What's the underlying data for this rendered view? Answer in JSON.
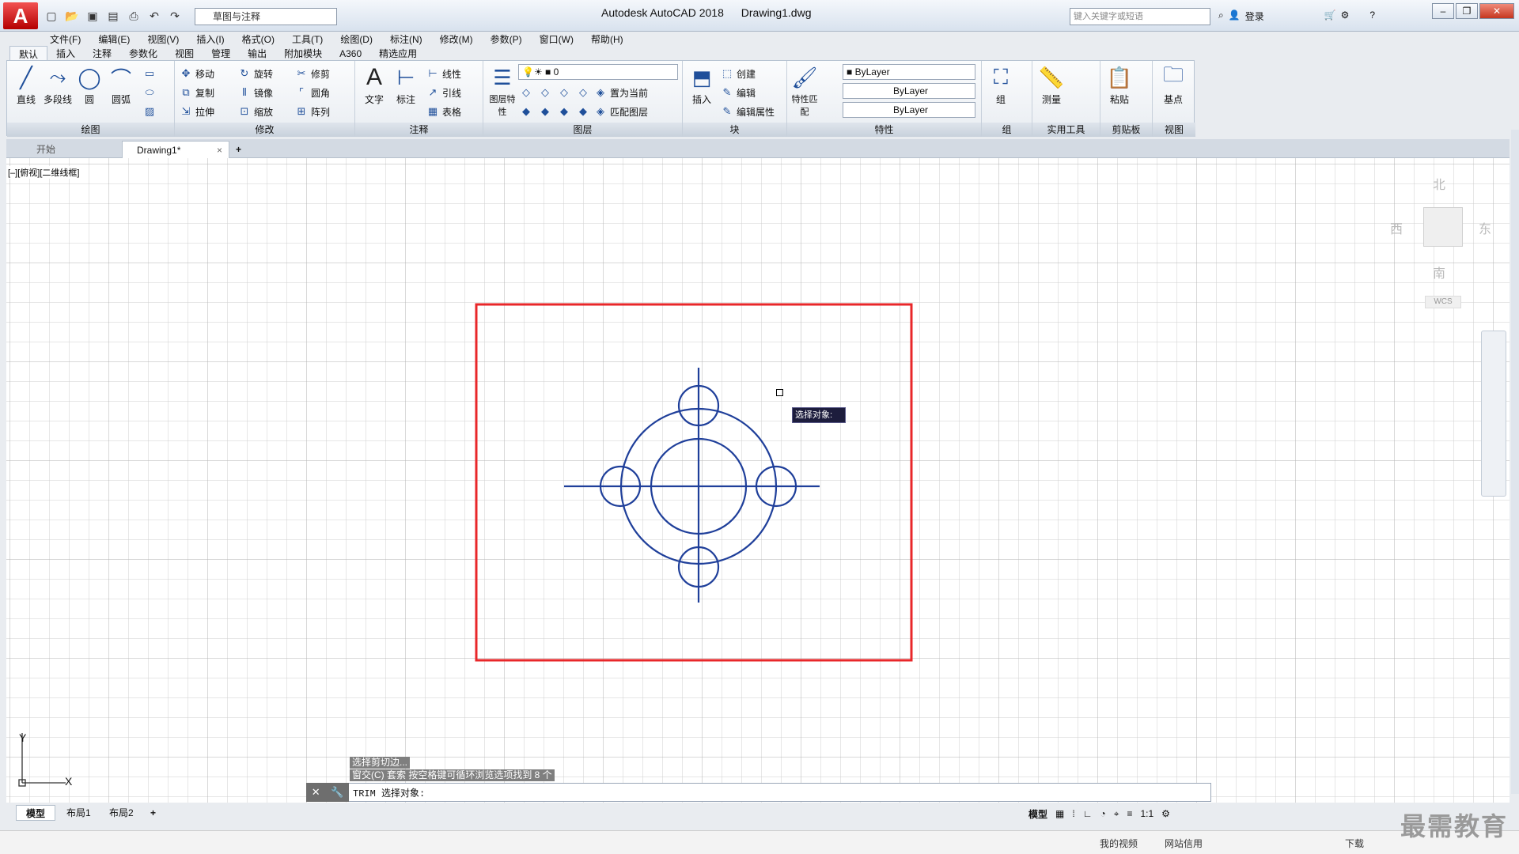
{
  "app": {
    "logo_letter": "A",
    "title": "Autodesk AutoCAD 2018",
    "file": "Drawing1.dwg"
  },
  "quick_access": {
    "workspace": "草图与注释"
  },
  "search": {
    "placeholder": "键入关键字或短语",
    "login": "登录"
  },
  "window_controls": {
    "minimize": "–",
    "restore": "❐",
    "close": "✕"
  },
  "menu": [
    "文件(F)",
    "编辑(E)",
    "视图(V)",
    "插入(I)",
    "格式(O)",
    "工具(T)",
    "绘图(D)",
    "标注(N)",
    "修改(M)",
    "参数(P)",
    "窗口(W)",
    "帮助(H)"
  ],
  "ribbon_tabs": [
    "默认",
    "插入",
    "注释",
    "参数化",
    "视图",
    "管理",
    "输出",
    "附加模块",
    "A360",
    "精选应用"
  ],
  "ribbon": {
    "draw": {
      "title": "绘图",
      "line": "直线",
      "polyline": "多段线",
      "circle": "圆",
      "arc": "圆弧"
    },
    "modify": {
      "title": "修改",
      "move": "移动",
      "rotate": "旋转",
      "trim": "修剪",
      "copy": "复制",
      "mirror": "镜像",
      "fillet": "圆角",
      "stretch": "拉伸",
      "scale": "缩放",
      "array": "阵列"
    },
    "annotation": {
      "title": "注释",
      "text": "文字",
      "dimension": "标注",
      "linear": "线性",
      "leader": "引线",
      "table": "表格"
    },
    "layers": {
      "title": "图层",
      "props": "图层特性",
      "current_layer": "0",
      "set_current": "置为当前",
      "match_layer": "匹配图层"
    },
    "block": {
      "title": "块",
      "insert": "插入",
      "create": "创建",
      "edit": "编辑",
      "edit_attr": "编辑属性"
    },
    "properties": {
      "title": "特性",
      "match": "特性匹配",
      "color": "ByLayer",
      "linetype": "ByLayer",
      "lineweight": "ByLayer"
    },
    "groups": {
      "title": "组",
      "group": "组"
    },
    "utilities": {
      "title": "实用工具",
      "measure": "测量"
    },
    "clipboard": {
      "title": "剪贴板",
      "paste": "粘贴"
    },
    "view": {
      "title": "视图",
      "base": "基点"
    }
  },
  "file_tabs": {
    "start": "开始",
    "drawing": "Drawing1*",
    "close": "×",
    "add": "+"
  },
  "viewport_label": "[–][俯视][二维线框]",
  "viewcube": {
    "north": "北",
    "south": "南",
    "east": "东",
    "west": "西",
    "wcs": "WCS"
  },
  "ucs": {
    "x": "X",
    "y": "Y"
  },
  "tooltip": "选择对象:",
  "command_history": [
    "选择剪切边...",
    "窗交(C) 套索  按空格键可循环浏览选项找到 8 个"
  ],
  "command_line": "TRIM 选择对象:",
  "layout_tabs": [
    "模型",
    "布局1",
    "布局2",
    "+"
  ],
  "status": {
    "model": "模型",
    "scale": "1:1"
  },
  "bottom": {
    "my_video": "我的视频",
    "net_credit": "网站信用",
    "download": "下载"
  },
  "watermark": "最需教育",
  "colors": {
    "frame": "#e8272a",
    "drawing": "#1f3f9a",
    "grid": "#c8c8c8"
  }
}
